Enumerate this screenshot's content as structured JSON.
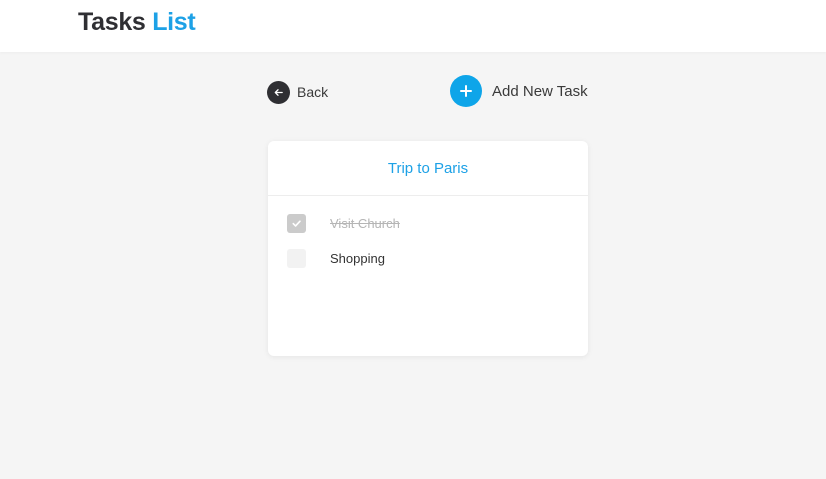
{
  "header": {
    "logo_part1": "Tasks",
    "logo_part2": "List"
  },
  "toolbar": {
    "back_label": "Back",
    "add_label": "Add New Task"
  },
  "list": {
    "title": "Trip to Paris",
    "tasks": [
      {
        "label": "Visit Church",
        "done": true
      },
      {
        "label": "Shopping",
        "done": false
      }
    ]
  },
  "colors": {
    "accent": "#1da1e6",
    "add_button": "#0ea5e9",
    "dark": "#2f2f33",
    "background": "#f5f5f5"
  },
  "icons": {
    "back": "arrow-left-icon",
    "add": "plus-icon",
    "check": "check-icon"
  }
}
